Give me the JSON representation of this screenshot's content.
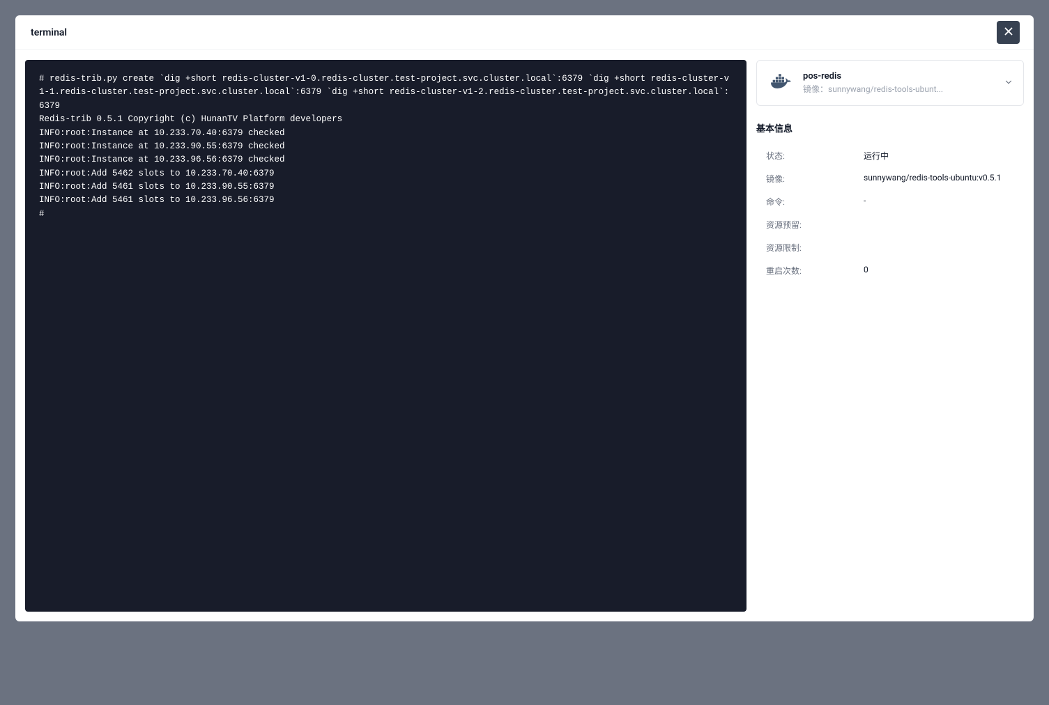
{
  "modal": {
    "title": "terminal"
  },
  "terminal": {
    "output": "# redis-trib.py create `dig +short redis-cluster-v1-0.redis-cluster.test-project.svc.cluster.local`:6379 `dig +short redis-cluster-v1-1.redis-cluster.test-project.svc.cluster.local`:6379 `dig +short redis-cluster-v1-2.redis-cluster.test-project.svc.cluster.local`:6379\nRedis-trib 0.5.1 Copyright (c) HunanTV Platform developers\nINFO:root:Instance at 10.233.70.40:6379 checked\nINFO:root:Instance at 10.233.90.55:6379 checked\nINFO:root:Instance at 10.233.96.56:6379 checked\nINFO:root:Add 5462 slots to 10.233.70.40:6379\nINFO:root:Add 5461 slots to 10.233.90.55:6379\nINFO:root:Add 5461 slots to 10.233.96.56:6379\n#"
  },
  "container": {
    "name": "pos-redis",
    "image_prefix": "镜像：",
    "image_short": "sunnywang/redis-tools-ubunt..."
  },
  "info": {
    "section_title": "基本信息",
    "rows": [
      {
        "label": "状态:",
        "value": "运行中"
      },
      {
        "label": "镜像:",
        "value": "sunnywang/redis-tools-ubuntu:v0.5.1"
      },
      {
        "label": "命令:",
        "value": "-"
      },
      {
        "label": "资源预留:",
        "value": ""
      },
      {
        "label": "资源限制:",
        "value": ""
      },
      {
        "label": "重启次数:",
        "value": "0"
      }
    ]
  }
}
